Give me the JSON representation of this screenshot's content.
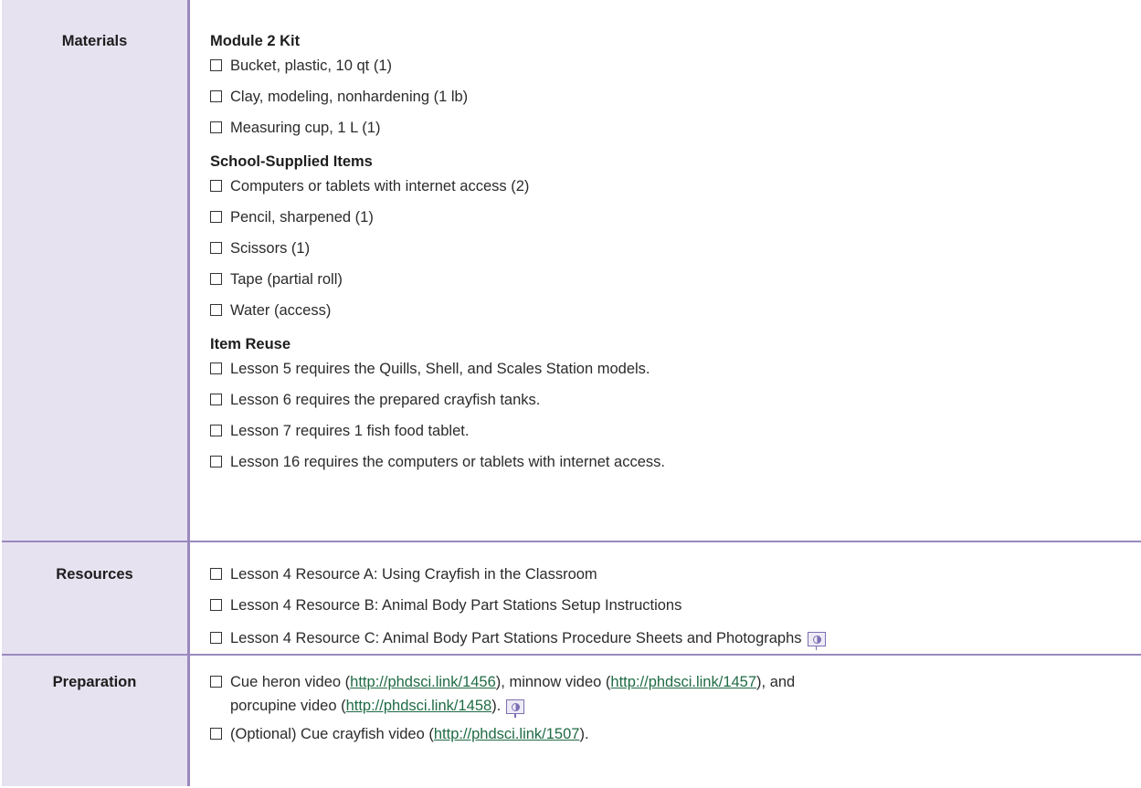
{
  "materials": {
    "label": "Materials",
    "groups": [
      {
        "heading": "Module 2 Kit",
        "items": [
          "Bucket, plastic, 10 qt (1)",
          "Clay, modeling, nonhardening (1 lb)",
          "Measuring cup, 1 L (1)"
        ]
      },
      {
        "heading": "School-Supplied Items",
        "items": [
          "Computers or tablets with internet access (2)",
          "Pencil, sharpened (1)",
          "Scissors (1)",
          "Tape (partial roll)",
          "Water (access)"
        ]
      },
      {
        "heading": "Item Reuse",
        "items": [
          "Lesson 5 requires the Quills, Shell, and Scales Station models.",
          "Lesson 6 requires the prepared crayfish tanks.",
          "Lesson 7 requires 1 fish food tablet.",
          "Lesson 16 requires the computers or tablets with internet access."
        ]
      }
    ]
  },
  "resources": {
    "label": "Resources",
    "items": [
      "Lesson 4 Resource A: Using Crayfish in the Classroom",
      "Lesson 4 Resource B: Animal Body Part Stations Setup Instructions",
      "Lesson 4 Resource C: Animal Body Part Stations Procedure Sheets and Photographs"
    ]
  },
  "preparation": {
    "label": "Preparation",
    "item1": {
      "t1": "Cue heron video (",
      "link1": "http://phdsci.link/1456",
      "t2": "), minnow video (",
      "link2": "http://phdsci.link/1457",
      "t3": "), and",
      "t4": "porcupine video (",
      "link3": "http://phdsci.link/1458",
      "t5": ")."
    },
    "item2": {
      "t1": "(Optional) Cue crayfish video (",
      "link1": "http://phdsci.link/1507",
      "t2": ")."
    }
  },
  "icons": {
    "presentation": "presentation-slide-icon"
  },
  "colors": {
    "border": "#9a89bf",
    "label_bg": "#e7e2f0",
    "link": "#1f6b44"
  }
}
